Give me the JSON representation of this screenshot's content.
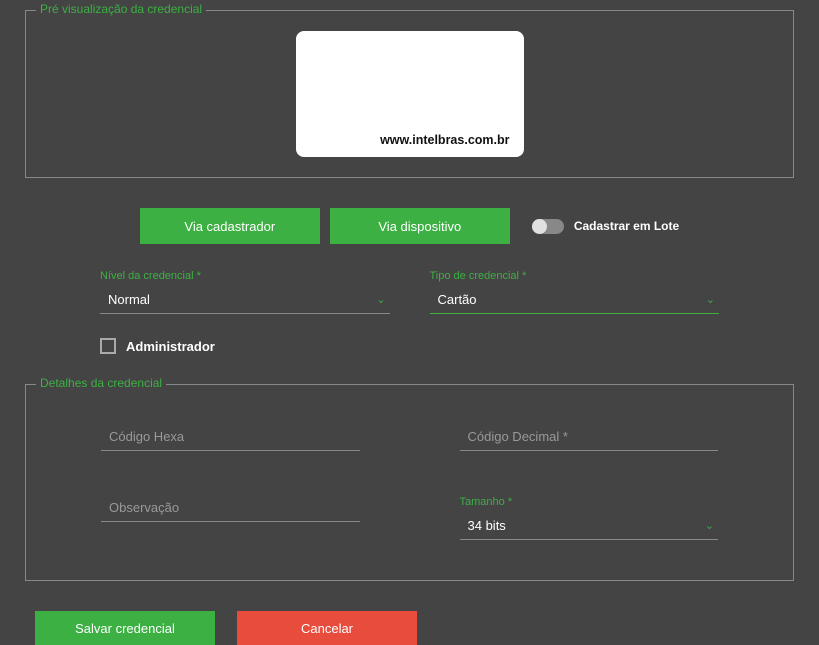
{
  "preview": {
    "title": "Pré visualização da credencial",
    "card_url": "www.intelbras.com.br"
  },
  "actions": {
    "via_cadastrador": "Via cadastrador",
    "via_dispositivo": "Via dispositivo",
    "batch_toggle_label": "Cadastrar em Lote"
  },
  "form": {
    "nivel": {
      "label": "Nível da credencial",
      "value": "Normal"
    },
    "tipo": {
      "label": "Tipo de credencial",
      "value": "Cartão"
    },
    "admin_label": "Administrador"
  },
  "details": {
    "title": "Detalhes da credencial",
    "codigo_hexa_placeholder": "Código Hexa",
    "codigo_decimal_placeholder": "Código Decimal *",
    "observacao_placeholder": "Observação",
    "tamanho": {
      "label": "Tamanho",
      "value": "34 bits"
    }
  },
  "footer": {
    "save": "Salvar credencial",
    "cancel": "Cancelar"
  },
  "asterisk": "*"
}
